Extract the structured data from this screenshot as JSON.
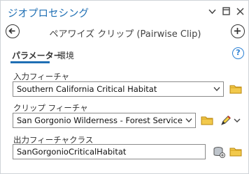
{
  "pane": {
    "title": "ジオプロセシング",
    "controls": {
      "menu": "▾",
      "pin": "⊓",
      "close": "✕"
    }
  },
  "tool": {
    "title": "ペアワイズ クリップ (Pairwise Clip)"
  },
  "tabs": [
    {
      "label": "パラメーター",
      "active": true
    },
    {
      "label": "環境",
      "active": false
    }
  ],
  "help_label": "?",
  "params": {
    "input": {
      "label": "入力フィーチャ",
      "value": "Southern California Critical Habitat"
    },
    "clip": {
      "label": "クリップ フィーチャ",
      "value": "San Gorgonio Wilderness - Forest Service"
    },
    "output": {
      "label": "出力フィーチャクラス",
      "value": "SanGorgonioCriticalHabitat"
    }
  },
  "colors": {
    "accent": "#1f6fb4",
    "folder": "#e6b53c",
    "help": "#2a7fd3"
  },
  "icons": [
    "back-arrow-icon",
    "add-icon",
    "help-icon",
    "folder-icon",
    "pencil-icon",
    "geodatabase-icon",
    "chevron-down-icon"
  ]
}
